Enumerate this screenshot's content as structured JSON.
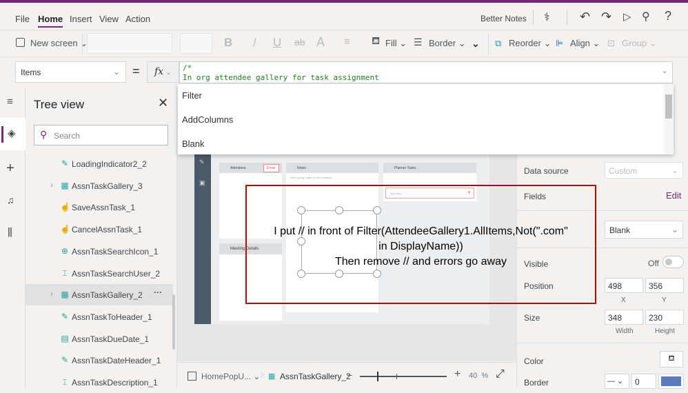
{
  "menu": {
    "tabs": [
      "File",
      "Home",
      "Insert",
      "View",
      "Action"
    ],
    "active": "Home",
    "app_name": "Better Notes"
  },
  "toolbar": {
    "new_screen": "New screen",
    "bold": "B",
    "italic": "/",
    "underline": "U",
    "font_color": "A",
    "fill": "Fill",
    "border": "Border",
    "reorder": "Reorder",
    "align": "Align",
    "group": "Group"
  },
  "formula_bar": {
    "property": "Items",
    "equals": "=",
    "fx": "fx",
    "line1": "/*",
    "line2": "In org attendee gallery for task assignment"
  },
  "suggestions": [
    "Filter",
    "AddColumns",
    "Blank"
  ],
  "tree": {
    "title": "Tree view",
    "search_placeholder": "Search",
    "items": [
      {
        "label": "LoadingIndicator2_2",
        "icon": "edit-label-icon"
      },
      {
        "label": "AssnTaskGallery_3",
        "icon": "gallery-icon",
        "expandable": true
      },
      {
        "label": "SaveAssnTask_1",
        "icon": "button-icon"
      },
      {
        "label": "CancelAssnTask_1",
        "icon": "button-icon"
      },
      {
        "label": "AssnTaskSearchIcon_1",
        "icon": "icons-icon"
      },
      {
        "label": "AssnTaskSearchUser_2",
        "icon": "text-input-icon"
      },
      {
        "label": "AssnTaskGallery_2",
        "icon": "gallery-icon",
        "expandable": true,
        "selected": true
      },
      {
        "label": "AssnTaskToHeader_1",
        "icon": "edit-label-icon"
      },
      {
        "label": "AssnTaskDueDate_1",
        "icon": "calendar-icon"
      },
      {
        "label": "AssnTaskDateHeader_1",
        "icon": "edit-label-icon"
      },
      {
        "label": "AssnTaskDescription_1",
        "icon": "text-input-icon"
      }
    ]
  },
  "preview": {
    "attendees": "Attendees",
    "email": "Email",
    "notes": "Notes",
    "notes_placeholder": "Start typing notes for this meeting...",
    "planner": "Planner Tasks",
    "add_task": "Add task...",
    "meeting_details": "Meeting Details"
  },
  "annotation": {
    "line1": "I put // in front of Filter(AttendeeGallery1.AllItems,Not(\".com\"",
    "line2": "in DisplayName))",
    "line3": "Then remove // and errors go away"
  },
  "properties": {
    "data_source_label": "Data source",
    "data_source_value": "Custom",
    "fields_label": "Fields",
    "fields_edit": "Edit",
    "layout_value": "Blank",
    "visible_label": "Visible",
    "visible_value": "Off",
    "visible_on": false,
    "position_label": "Position",
    "x": "498",
    "y": "356",
    "x_label": "X",
    "y_label": "Y",
    "size_label": "Size",
    "width": "348",
    "height": "230",
    "width_label": "Width",
    "height_label": "Height",
    "color_label": "Color",
    "border_label": "Border",
    "border_width": "0",
    "border_color": "#5b7bbd"
  },
  "bottom": {
    "screen": "HomePopU...",
    "control": "AssnTaskGallery_2",
    "zoom_minus": "−",
    "zoom_plus": "+",
    "zoom_value": "40",
    "zoom_unit": "%",
    "zoom_fraction": 0.4
  },
  "colors": {
    "accent": "#742774",
    "annotation": "#c00000"
  }
}
